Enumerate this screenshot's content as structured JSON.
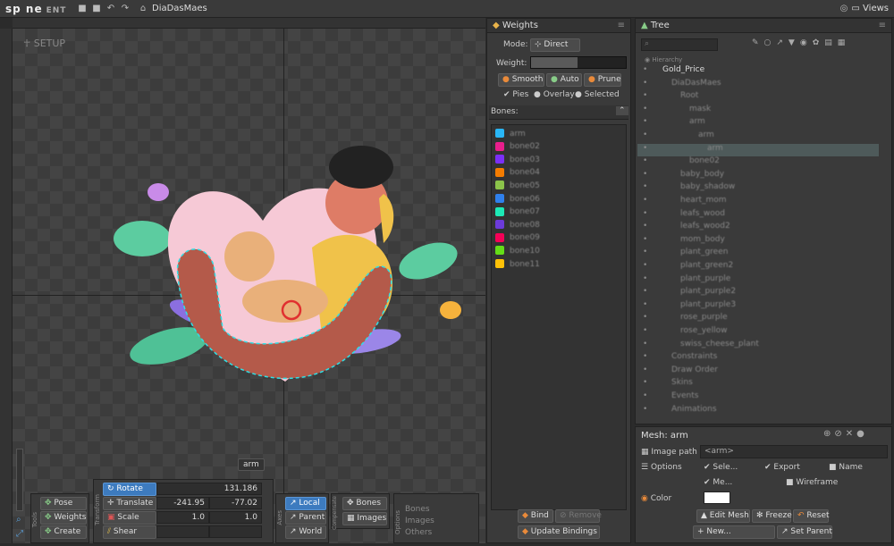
{
  "app": {
    "logo": "sp ne",
    "edition": "ENT",
    "project": "DiaDasMaes",
    "views_label": "Views"
  },
  "viewport": {
    "mode_label": "SETUP",
    "selected_tag": "arm"
  },
  "toolbar": {
    "tools_group": "Tools",
    "pose": "Pose",
    "weights": "Weights",
    "create": "Create",
    "transform_group": "Transform",
    "rotate": {
      "label": "Rotate",
      "value": "131.186"
    },
    "translate": {
      "label": "Translate",
      "x": "-241.95",
      "y": "-77.02"
    },
    "scale": {
      "label": "Scale",
      "x": "1.0",
      "y": "1.0"
    },
    "shear": {
      "label": "Shear"
    },
    "axes_group": "Axes",
    "local": "Local",
    "parent": "Parent",
    "world": "World",
    "compensate_group": "Compensate",
    "bones": "Bones",
    "images": "Images",
    "options_group": "Options",
    "opt_bones": "Bones",
    "opt_images": "Images",
    "opt_others": "Others"
  },
  "weights": {
    "title": "Weights",
    "mode_label": "Mode:",
    "mode_value": "Direct",
    "weight_label": "Weight:",
    "smooth": "Smooth",
    "auto": "Auto",
    "prune": "Prune",
    "pies": "Pies",
    "overlay": "Overlay",
    "selected": "Selected",
    "bones_label": "Bones:",
    "bones": [
      {
        "name": "arm",
        "color": "#29b6f6"
      },
      {
        "name": "bone02",
        "color": "#e91e8c"
      },
      {
        "name": "bone03",
        "color": "#7b2ff7"
      },
      {
        "name": "bone04",
        "color": "#f57c00"
      },
      {
        "name": "bone05",
        "color": "#8bc34a"
      },
      {
        "name": "bone06",
        "color": "#2f80ed"
      },
      {
        "name": "bone07",
        "color": "#1de9b6"
      },
      {
        "name": "bone08",
        "color": "#6c3bd9"
      },
      {
        "name": "bone09",
        "color": "#f50057"
      },
      {
        "name": "bone10",
        "color": "#64dd17"
      },
      {
        "name": "bone11",
        "color": "#ffc107"
      }
    ],
    "bind": "Bind",
    "remove": "Remove",
    "update_bindings": "Update Bindings"
  },
  "tree": {
    "title": "Tree",
    "hierarchy": "Hierarchy",
    "items": [
      {
        "label": "Gold_Price",
        "indent": 0,
        "sel": false,
        "faded": false
      },
      {
        "label": "DiaDasMaes",
        "indent": 1,
        "sel": false,
        "faded": true
      },
      {
        "label": "Root",
        "indent": 2,
        "sel": false,
        "faded": true
      },
      {
        "label": "mask",
        "indent": 3,
        "sel": false,
        "faded": true
      },
      {
        "label": "arm",
        "indent": 3,
        "sel": false,
        "faded": true
      },
      {
        "label": "arm",
        "indent": 4,
        "sel": false,
        "faded": true
      },
      {
        "label": "arm",
        "indent": 5,
        "sel": true,
        "faded": true
      },
      {
        "label": "bone02",
        "indent": 3,
        "sel": false,
        "faded": true
      },
      {
        "label": "baby_body",
        "indent": 2,
        "sel": false,
        "faded": true
      },
      {
        "label": "baby_shadow",
        "indent": 2,
        "sel": false,
        "faded": true
      },
      {
        "label": "heart_mom",
        "indent": 2,
        "sel": false,
        "faded": true
      },
      {
        "label": "leafs_wood",
        "indent": 2,
        "sel": false,
        "faded": true
      },
      {
        "label": "leafs_wood2",
        "indent": 2,
        "sel": false,
        "faded": true
      },
      {
        "label": "mom_body",
        "indent": 2,
        "sel": false,
        "faded": true
      },
      {
        "label": "plant_green",
        "indent": 2,
        "sel": false,
        "faded": true
      },
      {
        "label": "plant_green2",
        "indent": 2,
        "sel": false,
        "faded": true
      },
      {
        "label": "plant_purple",
        "indent": 2,
        "sel": false,
        "faded": true
      },
      {
        "label": "plant_purple2",
        "indent": 2,
        "sel": false,
        "faded": true
      },
      {
        "label": "plant_purple3",
        "indent": 2,
        "sel": false,
        "faded": true
      },
      {
        "label": "rose_purple",
        "indent": 2,
        "sel": false,
        "faded": true
      },
      {
        "label": "rose_yellow",
        "indent": 2,
        "sel": false,
        "faded": true
      },
      {
        "label": "swiss_cheese_plant",
        "indent": 2,
        "sel": false,
        "faded": true
      },
      {
        "label": "Constraints",
        "indent": 1,
        "sel": false,
        "faded": true
      },
      {
        "label": "Draw Order",
        "indent": 1,
        "sel": false,
        "faded": true
      },
      {
        "label": "Skins",
        "indent": 1,
        "sel": false,
        "faded": true
      },
      {
        "label": "Events",
        "indent": 1,
        "sel": false,
        "faded": true
      },
      {
        "label": "Animations",
        "indent": 1,
        "sel": false,
        "faded": true
      }
    ]
  },
  "mesh": {
    "title": "Mesh: arm",
    "image_path_label": "Image path",
    "image_path_value": "<arm>",
    "options_label": "Options",
    "opt_sele": "Sele...",
    "opt_export": "Export",
    "opt_name": "Name",
    "opt_me": "Me...",
    "opt_wireframe": "Wireframe",
    "color_label": "Color",
    "color_value": "#ffffff",
    "edit_mesh": "Edit Mesh",
    "freeze": "Freeze",
    "reset": "Reset",
    "new": "New...",
    "set_parent": "Set Parent"
  }
}
